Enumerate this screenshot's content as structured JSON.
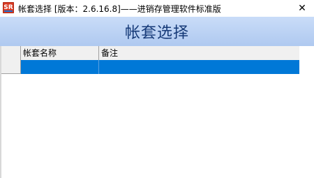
{
  "window": {
    "title": "帐套选择 [版本：2.6.16.8]——进销存管理软件标准版",
    "close_glyph": "✕",
    "icon": "app-logo-icon"
  },
  "banner": {
    "title": "帐套选择"
  },
  "table": {
    "columns": [
      "帐套名称",
      "备注"
    ],
    "rows": [
      {
        "name": "",
        "remark": "",
        "selected": true
      }
    ]
  },
  "colors": {
    "banner_top": "#c9dcf8",
    "banner_bottom": "#afc9f0",
    "banner_text": "#163a78",
    "selection": "#0078d7"
  }
}
